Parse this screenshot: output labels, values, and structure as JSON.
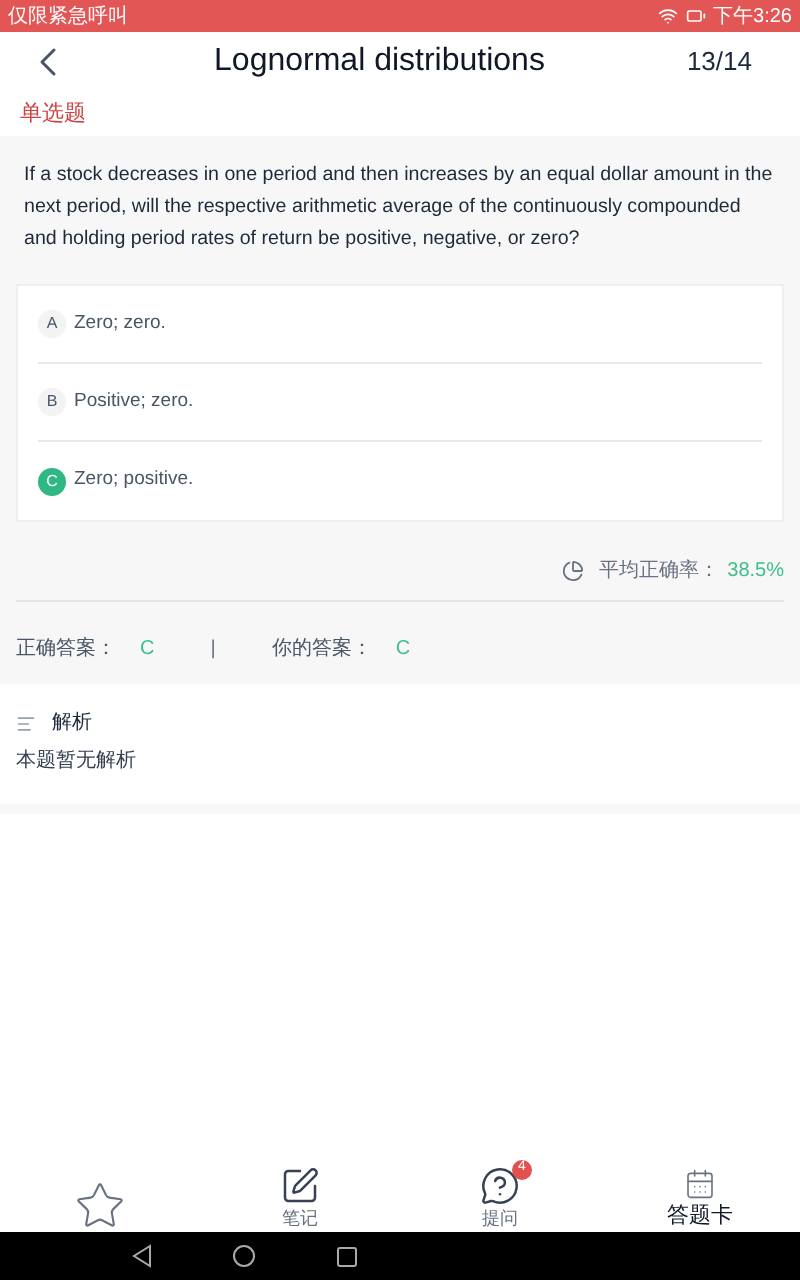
{
  "status_bar": {
    "carrier": "仅限紧急呼叫",
    "time": "下午3:26"
  },
  "header": {
    "title": "Lognormal distributions",
    "progress": "13/14"
  },
  "question_type": "单选题",
  "question": "If a stock decreases in one period and then increases by an equal dollar amount in the next period, will the respective arithmetic average of the continuously compounded and holding period rates of return be positive, negative, or zero?",
  "options": [
    {
      "letter": "A",
      "text": "Zero; zero.",
      "selected": false
    },
    {
      "letter": "B",
      "text": "Positive; zero.",
      "selected": false
    },
    {
      "letter": "C",
      "text": "Zero; positive.",
      "selected": true
    }
  ],
  "accuracy": {
    "label": "平均正确率：",
    "value": "38.5%"
  },
  "answers": {
    "correct_label": "正确答案：",
    "correct": "C",
    "separator": "|",
    "yours_label": "你的答案：",
    "yours": "C"
  },
  "analysis": {
    "title": "解析",
    "body": "本题暂无解析"
  },
  "bottom_bar": [
    {
      "kind": "notes",
      "label": "笔记"
    },
    {
      "kind": "ask",
      "label": "提问",
      "badge": "4"
    },
    {
      "kind": "card",
      "label": "答题卡"
    }
  ]
}
